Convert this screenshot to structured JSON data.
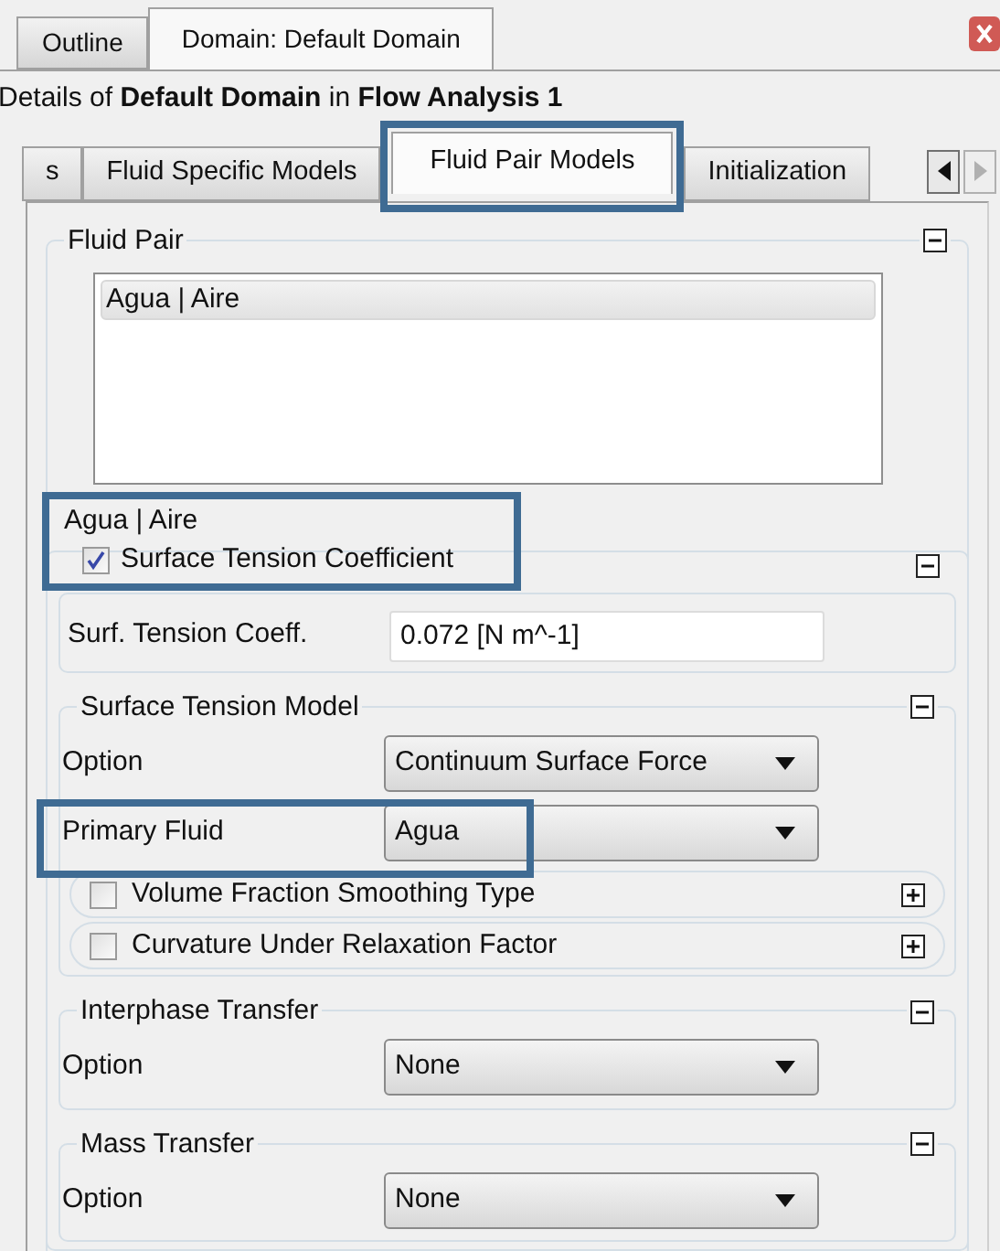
{
  "panel_tabs": [
    {
      "label": "Outline",
      "selected": false
    },
    {
      "label": "Domain: Default Domain",
      "selected": true
    }
  ],
  "details": "Details of **Default Domain** in **Flow Analysis 1**",
  "tabs": [
    {
      "label": "s",
      "selected": false,
      "highlighted": false
    },
    {
      "label": "Fluid Specific Models",
      "selected": false,
      "highlighted": false
    },
    {
      "label": "Fluid Pair Models",
      "selected": true,
      "highlighted": true
    },
    {
      "label": "Initialization",
      "selected": false,
      "highlighted": false
    }
  ],
  "fluid_pair": {
    "title": "Fluid Pair",
    "expanded": true,
    "items": [
      {
        "label": "Agua | Aire",
        "selected": true
      }
    ]
  },
  "pair_settings": {
    "title": "Agua | Aire",
    "highlighted": true,
    "option": {
      "label": "Surface Tension Coefficient",
      "checked": true,
      "expanded": true
    },
    "field": {
      "label": "Surf. Tension Coeff.",
      "value": "0.072 [N m^-1]"
    }
  },
  "sections": [
    {
      "title": "Surface Tension Model",
      "expanded": true,
      "rows": [
        {
          "label": "Option",
          "value": "Continuum Surface Force",
          "highlighted": false
        },
        {
          "label": "Primary Fluid",
          "value": "Agua",
          "highlighted": true
        }
      ],
      "options": [
        {
          "label": "Volume Fraction Smoothing Type",
          "checked": false,
          "expanded": false
        },
        {
          "label": "Curvature Under Relaxation Factor",
          "checked": false,
          "expanded": false
        }
      ]
    },
    {
      "title": "Interphase Transfer",
      "expanded": true,
      "rows": [
        {
          "label": "Option",
          "value": "None",
          "highlighted": false
        }
      ]
    },
    {
      "title": "Mass Transfer",
      "expanded": true,
      "rows": [
        {
          "label": "Option",
          "value": "None",
          "highlighted": false
        }
      ]
    }
  ]
}
